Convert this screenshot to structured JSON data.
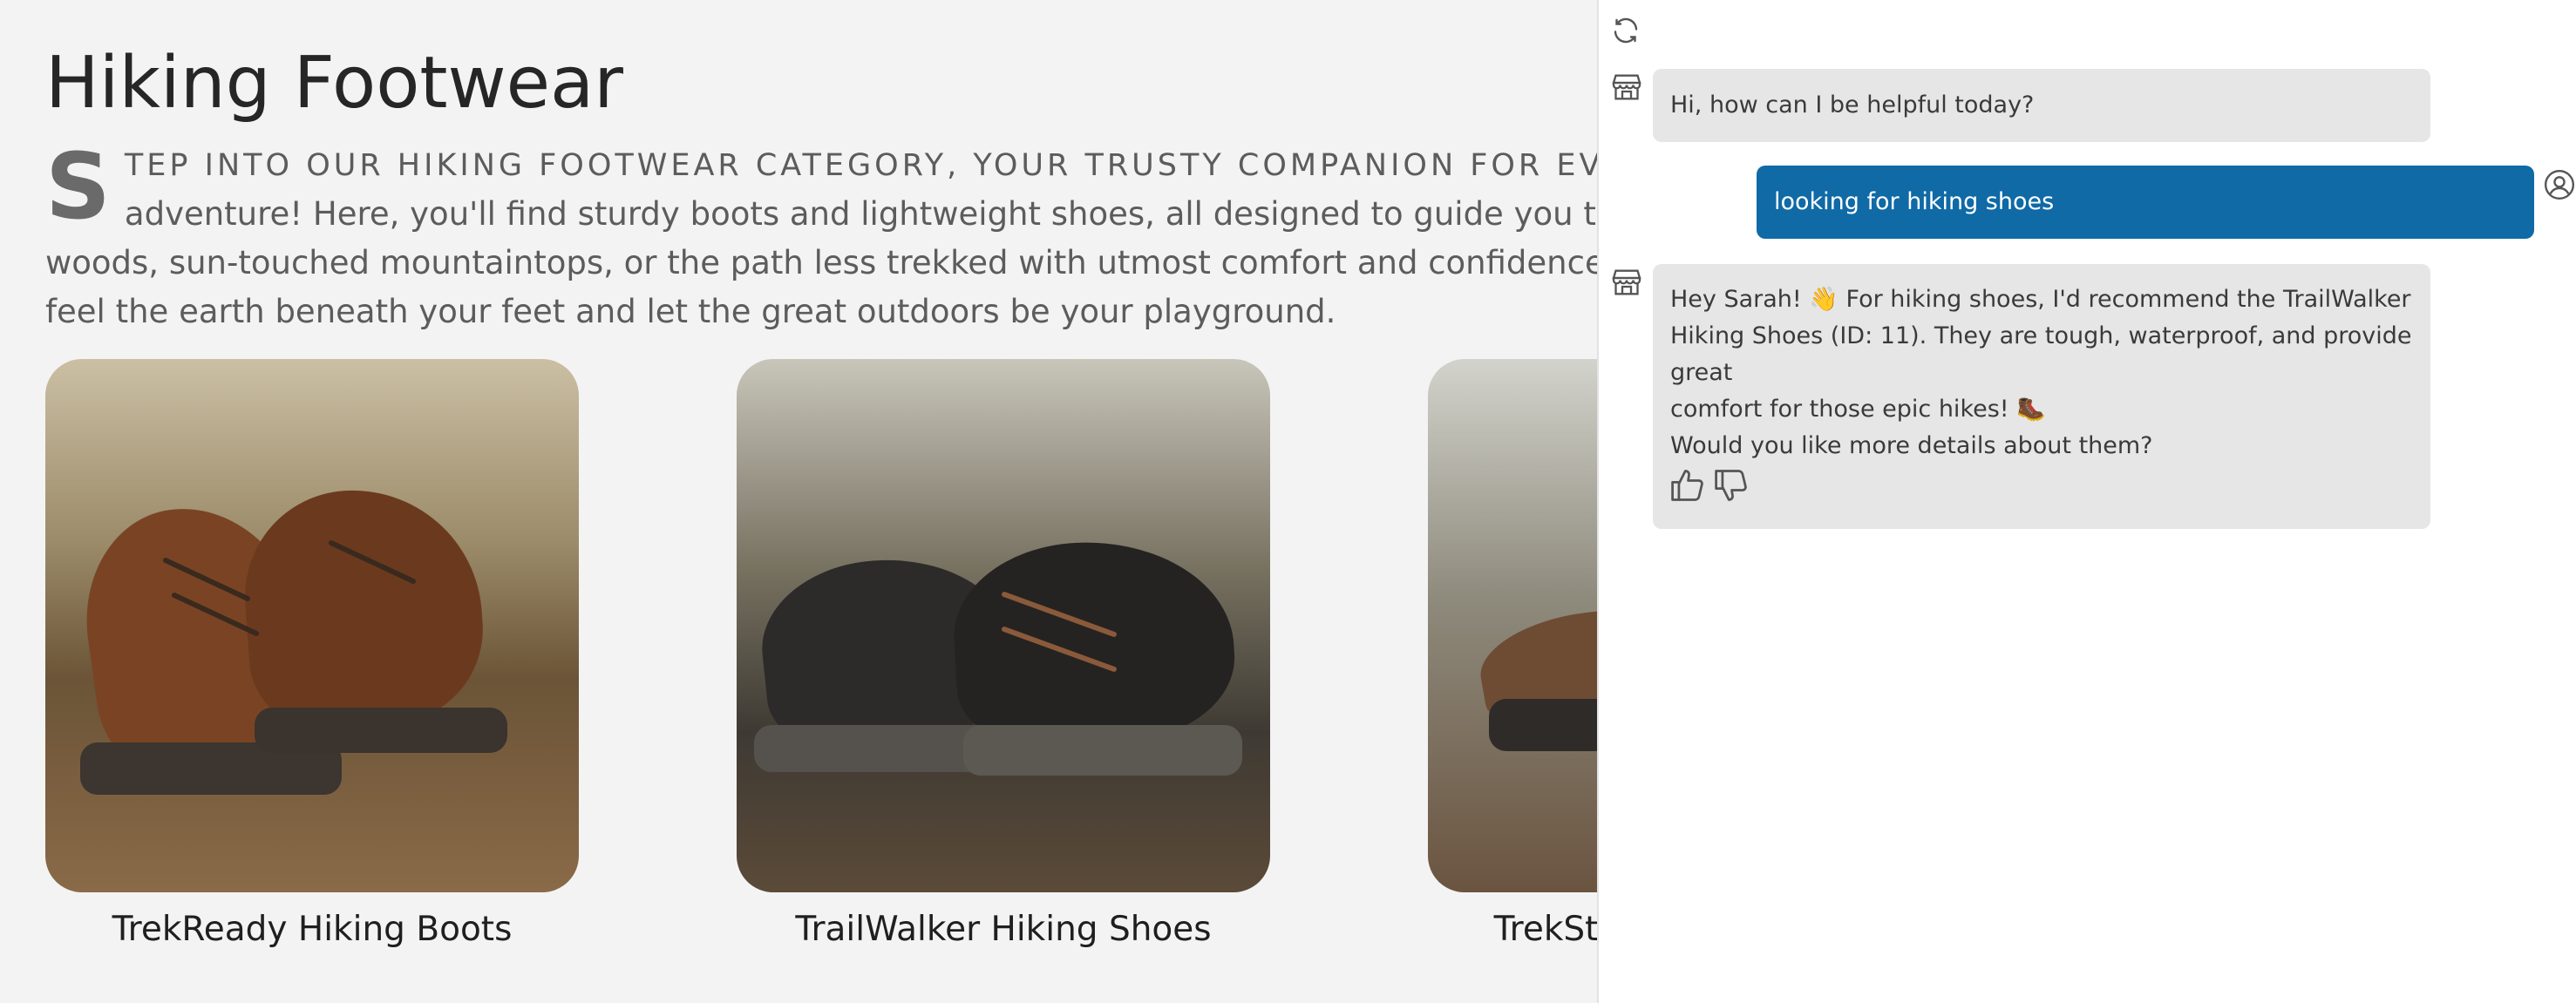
{
  "page": {
    "title": "Hiking Footwear",
    "intro": {
      "dropcap": "S",
      "caps_line": "TEP INTO OUR HIKING FOOTWEAR CATEGORY, YOUR TRUSTY COMPANION FOR EVERY",
      "line2": "adventure! Here, you'll find sturdy boots and lightweight shoes, all designed to guide you through tranquil",
      "line3": "woods, sun-touched mountaintops, or the path less trekked with utmost comfort and confidence. Step in,",
      "line4": "feel the earth beneath your feet and let the great outdoors be your playground."
    },
    "products": [
      {
        "name": "TrekReady Hiking Boots"
      },
      {
        "name": "TrailWalker Hiking Shoes"
      },
      {
        "name": "TrekStar Hiking Sandals"
      }
    ]
  },
  "chat": {
    "icons": {
      "refresh": "refresh-icon",
      "bot": "store-icon",
      "user": "user-circle-icon",
      "like": "thumbs-up-icon",
      "dislike": "thumbs-down-icon"
    },
    "messages": [
      {
        "role": "assistant",
        "text": "Hi, how can I be helpful today?"
      },
      {
        "role": "user",
        "text": "looking for hiking shoes"
      },
      {
        "role": "assistant",
        "line1": "Hey Sarah! 👋 For hiking shoes, I'd recommend the TrailWalker",
        "line2": "Hiking Shoes (ID: 11). They are tough, waterproof, and provide great",
        "line3": "comfort for those epic hikes! 🥾",
        "line4": "Would you like more details about them?"
      }
    ],
    "colors": {
      "user_bubble": "#0f6aa6",
      "bot_bubble": "#e6e6e6"
    }
  }
}
